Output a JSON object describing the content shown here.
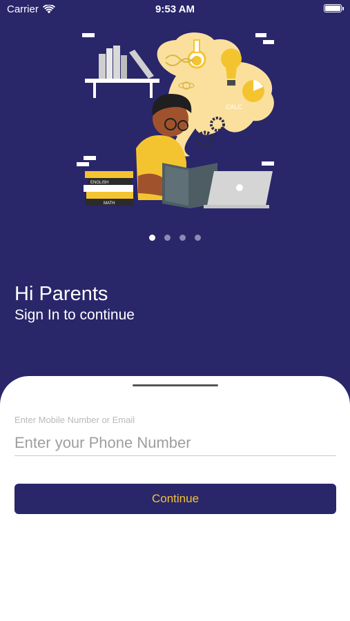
{
  "status_bar": {
    "carrier": "Carrier",
    "time": "9:53 AM"
  },
  "illustration": {
    "book_labels": [
      "ENGLISH",
      "MATH"
    ],
    "calc_text": "CALC"
  },
  "pager": {
    "count": 4,
    "active_index": 0
  },
  "greeting": {
    "title": "Hi Parents",
    "subtitle": "Sign In to continue"
  },
  "login": {
    "field_label": "Enter Mobile Number or Email",
    "phone_placeholder": "Enter your Phone Number",
    "phone_value": "",
    "continue_label": "Continue"
  },
  "colors": {
    "background": "#29266a",
    "accent_yellow": "#f4c430",
    "sheet": "#ffffff"
  },
  "icons": [
    "wifi-icon",
    "battery-icon"
  ]
}
